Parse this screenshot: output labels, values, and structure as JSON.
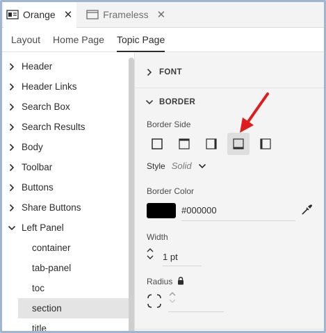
{
  "doc_tabs": [
    {
      "label": "Orange",
      "icon": "layout-icon",
      "close": "✕"
    },
    {
      "label": "Frameless",
      "icon": "window-icon",
      "close": "✕"
    }
  ],
  "sub_tabs": [
    "Layout",
    "Home Page",
    "Topic Page"
  ],
  "active_sub_tab": "Topic Page",
  "tree": {
    "items": [
      {
        "label": "Header",
        "expanded": false
      },
      {
        "label": "Header Links",
        "expanded": false
      },
      {
        "label": "Search Box",
        "expanded": false
      },
      {
        "label": "Search Results",
        "expanded": false
      },
      {
        "label": "Body",
        "expanded": false
      },
      {
        "label": "Toolbar",
        "expanded": false
      },
      {
        "label": "Buttons",
        "expanded": false
      },
      {
        "label": "Share Buttons",
        "expanded": false
      },
      {
        "label": "Left Panel",
        "expanded": true
      }
    ],
    "children": [
      {
        "label": "container"
      },
      {
        "label": "tab-panel"
      },
      {
        "label": "toc"
      },
      {
        "label": "section",
        "selected": true
      },
      {
        "label": "title"
      }
    ]
  },
  "panel": {
    "font_section": "FONT",
    "border_section": "BORDER",
    "border_side_label": "Border Side",
    "border_sides": [
      "all",
      "top",
      "right",
      "bottom",
      "left"
    ],
    "active_border_side": "bottom",
    "style_label": "Style",
    "style_value": "Solid",
    "border_color_label": "Border Color",
    "border_color": "#000000",
    "border_color_text": "#000000",
    "width_label": "Width",
    "width_value": "1 pt",
    "radius_label": "Radius",
    "radius_value": ""
  },
  "colors": {
    "accent_arrow": "#e01b1b",
    "frame_border": "#9eb6d2",
    "selected_row": "#e4e4e4"
  }
}
